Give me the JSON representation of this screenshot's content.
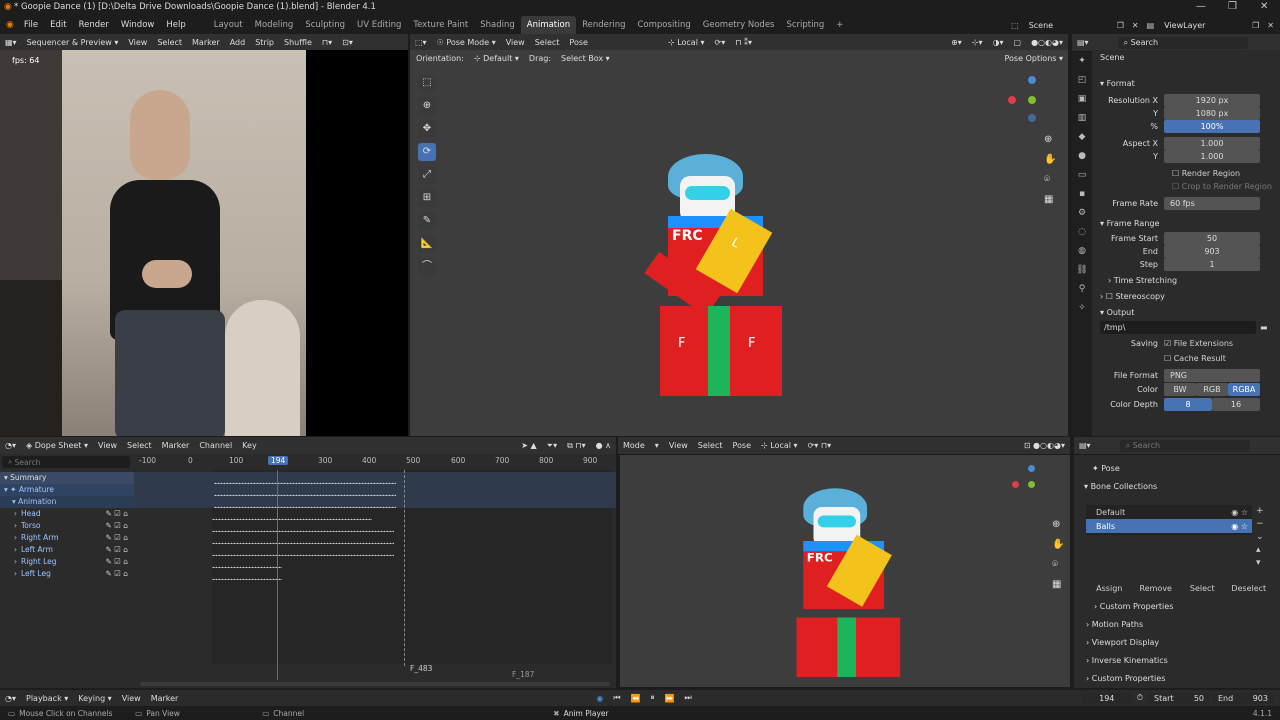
{
  "window": {
    "title": "* Goopie Dance (1) [D:\\Delta Drive Downloads\\Goopie Dance (1).blend] - Blender 4.1"
  },
  "menu": [
    "File",
    "Edit",
    "Render",
    "Window",
    "Help"
  ],
  "workspaces": [
    "Layout",
    "Modeling",
    "Sculpting",
    "UV Editing",
    "Texture Paint",
    "Shading",
    "Animation",
    "Rendering",
    "Compositing",
    "Geometry Nodes",
    "Scripting"
  ],
  "active_workspace": "Animation",
  "scene": {
    "scene_name": "Scene",
    "view_layer": "ViewLayer"
  },
  "sequencer": {
    "mode": "Sequencer & Preview",
    "menus": [
      "View",
      "Select",
      "Marker",
      "Add",
      "Strip"
    ],
    "shuffle": "Shuffle",
    "fps": "fps: 64"
  },
  "viewport": {
    "mode": "Pose Mode",
    "menus": [
      "View",
      "Select",
      "Pose"
    ],
    "transform": "Local",
    "orientation_label": "Orientation:",
    "orientation_value": "Default",
    "drag_label": "Drag:",
    "drag_value": "Select Box",
    "pose_options": "Pose Options"
  },
  "properties": {
    "scene_label": "Scene",
    "format_section": "Format",
    "resolution_x_label": "Resolution X",
    "resolution_x": "1920 px",
    "y_label": "Y",
    "resolution_y": "1080 px",
    "pct_label": "%",
    "resolution_pct": "100%",
    "aspect_x_label": "Aspect X",
    "aspect_x": "1.000",
    "aspect_y_label": "Y",
    "aspect_y": "1.000",
    "render_region": "Render Region",
    "crop_region": "Crop to Render Region",
    "frame_rate_label": "Frame Rate",
    "frame_rate": "60 fps",
    "frame_range_section": "Frame Range",
    "frame_start_label": "Frame Start",
    "frame_start": "50",
    "end_label": "End",
    "frame_end": "903",
    "step_label": "Step",
    "frame_step": "1",
    "time_stretching": "Time Stretching",
    "stereoscopy": "Stereoscopy",
    "output_section": "Output",
    "output_path": "/tmp\\",
    "saving_label": "Saving",
    "file_extensions": "File Extensions",
    "cache_result": "Cache Result",
    "file_format_label": "File Format",
    "file_format": "PNG",
    "color_label": "Color",
    "color_bw": "BW",
    "color_rgb": "RGB",
    "color_rgba": "RGBA",
    "color_depth_label": "Color Depth",
    "depth_8": "8",
    "depth_16": "16"
  },
  "dopesheet": {
    "mode": "Dope Sheet",
    "menus": [
      "View",
      "Select",
      "Marker",
      "Channel",
      "Key"
    ],
    "search_placeholder": "Search",
    "ruler": [
      "-100",
      "0",
      "100",
      "194",
      "300",
      "400",
      "500",
      "600",
      "700",
      "800",
      "900"
    ],
    "current_frame": "194",
    "channels": [
      {
        "name": "Summary",
        "level": 0
      },
      {
        "name": "Armature",
        "level": 0
      },
      {
        "name": "Animation",
        "level": 1
      },
      {
        "name": "Head",
        "level": 2
      },
      {
        "name": "Torso",
        "level": 2
      },
      {
        "name": "Right Arm",
        "level": 2
      },
      {
        "name": "Left Arm",
        "level": 2
      },
      {
        "name": "Right Leg",
        "level": 2
      },
      {
        "name": "Left Leg",
        "level": 2
      }
    ],
    "marker_a": "F_483",
    "marker_b": "F_187"
  },
  "viewport2": {
    "mode": "Mode",
    "menus": [
      "View",
      "Select",
      "Pose"
    ],
    "transform": "Local"
  },
  "bone_panel": {
    "pose": "Pose",
    "bone_collections": "Bone Collections",
    "collections": [
      "Default",
      "Balls"
    ],
    "assign": "Assign",
    "remove": "Remove",
    "select": "Select",
    "deselect": "Deselect",
    "custom_properties": "Custom Properties",
    "motion_paths": "Motion Paths",
    "viewport_display": "Viewport Display",
    "inverse_kinematics": "Inverse Kinematics",
    "custom_properties2": "Custom Properties"
  },
  "timeline": {
    "menus": [
      "Playback",
      "Keying",
      "View",
      "Marker"
    ],
    "current": "194",
    "start_label": "Start",
    "start": "50",
    "end_label": "End",
    "end": "903"
  },
  "status": {
    "left": "Mouse Click on Channels",
    "mid": "Pan View",
    "channel": "Channel",
    "center": "Anim Player",
    "version": "4.1.1"
  },
  "character_text": {
    "chest": "FRC",
    "letter": "F",
    "arm_letter": "L"
  }
}
